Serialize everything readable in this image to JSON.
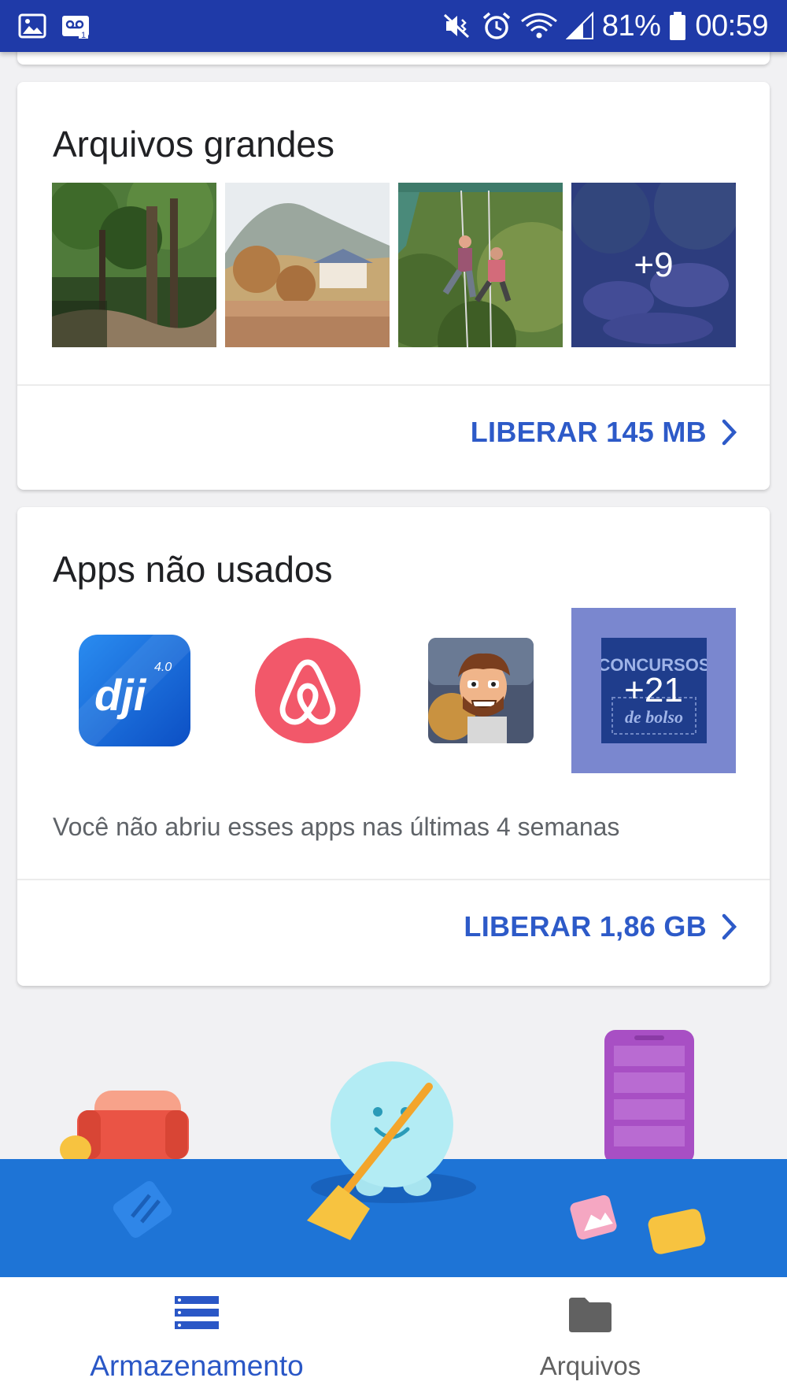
{
  "status_bar": {
    "battery": "81%",
    "time": "00:59",
    "left_icons": [
      "image-notification-icon",
      "voicemail-icon"
    ],
    "right_icons": [
      "mute-vibrate-icon",
      "alarm-icon",
      "wifi-icon",
      "signal-icon",
      "battery-icon"
    ]
  },
  "large_files": {
    "title": "Arquivos grandes",
    "more_count": "+9",
    "action_label": "LIBERAR 145 MB"
  },
  "unused_apps": {
    "title": "Apps não usados",
    "app_icons": [
      "dji-go-app",
      "airbnb-app",
      "jetpack-joyride-app",
      "concursos-de-bolso-app"
    ],
    "dji_label": "dji",
    "dji_version": "4.0",
    "concursos_top": "CONCURSOS",
    "concursos_bottom": "de bolso",
    "more_count": "+21",
    "note": "Você não abriu esses apps nas últimas 4 semanas",
    "action_label": "LIBERAR 1,86 GB"
  },
  "bottom_nav": {
    "items": [
      {
        "label": "Armazenamento",
        "icon": "storage-list-icon",
        "active": true
      },
      {
        "label": "Arquivos",
        "icon": "folder-icon",
        "active": false
      }
    ]
  },
  "colors": {
    "status_bar": "#1f3aa8",
    "accent": "#2d5ac8",
    "illustration_floor": "#1e74d6"
  }
}
